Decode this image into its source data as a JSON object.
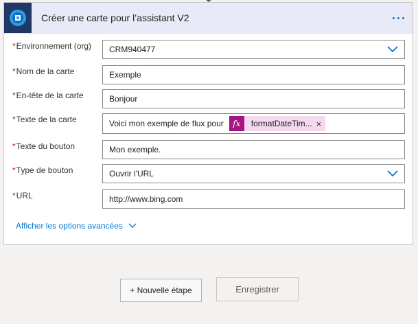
{
  "card": {
    "title": "Créer une carte pour l’assistant V2",
    "more_icon": "more-dots-icon",
    "app_icon": "dynamics-app-icon"
  },
  "fields": {
    "required_marker": "*",
    "environment": {
      "label": "Environnement (org)",
      "value": "CRM940477"
    },
    "card_name": {
      "label": "Nom de la carte",
      "value": "Exemple"
    },
    "card_header": {
      "label": "En-tête de la carte",
      "value": "Bonjour"
    },
    "card_text": {
      "label": "Texte de la carte",
      "value": "Voici mon exemple de flux pour",
      "token_label": "formatDateTim...",
      "token_icon_text": "fx",
      "token_remove": "×"
    },
    "button_text": {
      "label": "Texte du bouton",
      "value": "Mon exemple."
    },
    "button_type": {
      "label": "Type de bouton",
      "value": "Ouvrir l'URL"
    },
    "url": {
      "label": "URL",
      "value": "http://www.bing.com"
    }
  },
  "advanced": {
    "label": "Afficher les options avancées"
  },
  "actions": {
    "new_step": "+ Nouvelle étape",
    "save": "Enregistrer"
  },
  "colors": {
    "accent": "#0078d4",
    "header_bg": "#e8ebf7",
    "token_bg": "#f4d9ee",
    "token_icon_bg": "#a41583",
    "required": "#a4262c"
  }
}
